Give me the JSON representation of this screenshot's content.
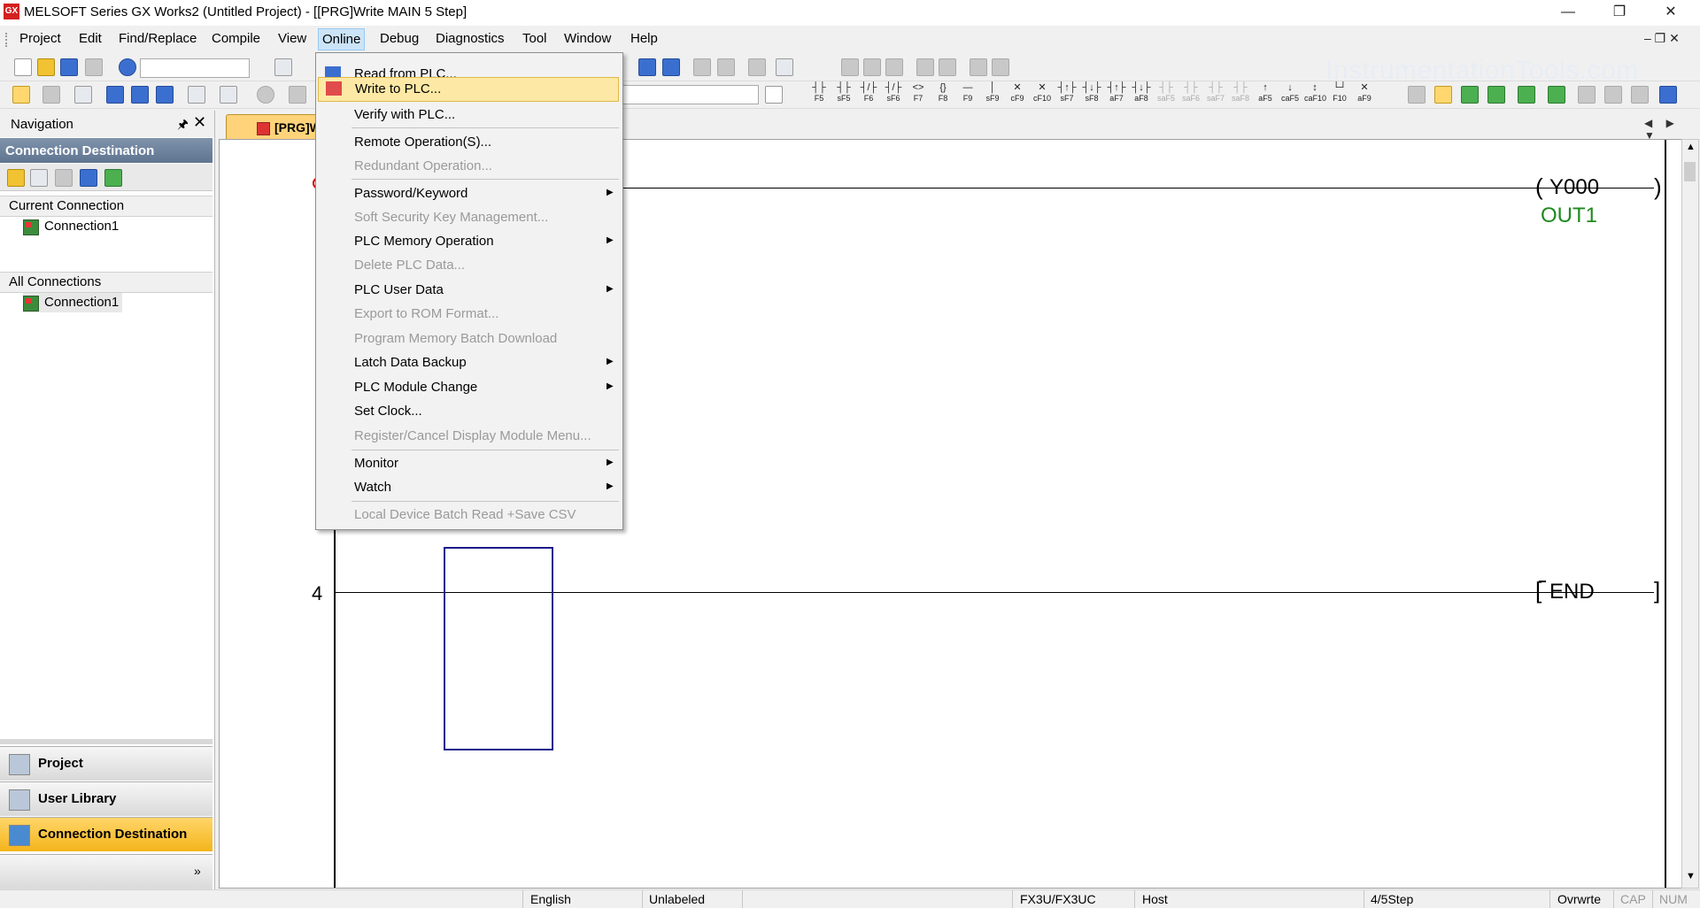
{
  "window": {
    "title": "MELSOFT Series GX Works2 (Untitled Project) - [[PRG]Write MAIN 5 Step]",
    "logo_text": "GX",
    "controls": {
      "minimize": "—",
      "restore": "❐",
      "close": "✕"
    },
    "mdi_controls": "‒ ❐ ✕"
  },
  "menubar": {
    "items": [
      {
        "label": "Project"
      },
      {
        "label": "Edit"
      },
      {
        "label": "Find/Replace"
      },
      {
        "label": "Compile"
      },
      {
        "label": "View"
      },
      {
        "label": "Online",
        "open": true
      },
      {
        "label": "Debug"
      },
      {
        "label": "Diagnostics"
      },
      {
        "label": "Tool"
      },
      {
        "label": "Window"
      },
      {
        "label": "Help"
      }
    ]
  },
  "online_menu": {
    "items": [
      {
        "label": "Read from PLC...",
        "enabled": true,
        "icon": "read-from-plc-icon"
      },
      {
        "label": "Write to PLC...",
        "enabled": true,
        "highlighted": true,
        "icon": "write-to-plc-icon"
      },
      {
        "label": "Verify with PLC...",
        "enabled": true
      },
      {
        "label": "Remote Operation(S)...",
        "enabled": true
      },
      {
        "label": "Redundant Operation...",
        "enabled": false
      },
      {
        "label": "Password/Keyword",
        "enabled": true,
        "submenu": true
      },
      {
        "label": "Soft Security Key Management...",
        "enabled": false
      },
      {
        "label": "PLC Memory Operation",
        "enabled": true,
        "submenu": true
      },
      {
        "label": "Delete PLC Data...",
        "enabled": false
      },
      {
        "label": "PLC User Data",
        "enabled": true,
        "submenu": true
      },
      {
        "label": "Export to ROM Format...",
        "enabled": false
      },
      {
        "label": "Program Memory Batch Download",
        "enabled": false
      },
      {
        "label": "Latch Data Backup",
        "enabled": true,
        "submenu": true
      },
      {
        "label": "PLC Module Change",
        "enabled": true,
        "submenu": true
      },
      {
        "label": "Set Clock...",
        "enabled": true
      },
      {
        "label": "Register/Cancel Display Module Menu...",
        "enabled": false
      },
      {
        "label": "Monitor",
        "enabled": true,
        "submenu": true
      },
      {
        "label": "Watch",
        "enabled": true,
        "submenu": true
      },
      {
        "label": "Local Device Batch Read +Save CSV",
        "enabled": false
      }
    ]
  },
  "function_keys": [
    {
      "sym": "┤├",
      "label": "F5"
    },
    {
      "sym": "┤├",
      "label": "sF5"
    },
    {
      "sym": "┤/├",
      "label": "F6"
    },
    {
      "sym": "┤/├",
      "label": "sF6"
    },
    {
      "sym": "<>",
      "label": "F7"
    },
    {
      "sym": "{}",
      "label": "F8"
    },
    {
      "sym": "—",
      "label": "F9"
    },
    {
      "sym": "│",
      "label": "sF9"
    },
    {
      "sym": "✕",
      "label": "cF9"
    },
    {
      "sym": "✕",
      "label": "cF10"
    },
    {
      "sym": "┤↑├",
      "label": "sF7"
    },
    {
      "sym": "┤↓├",
      "label": "sF8"
    },
    {
      "sym": "┤↑├",
      "label": "aF7"
    },
    {
      "sym": "┤↓├",
      "label": "aF8"
    },
    {
      "sym": "┤├",
      "label": "saF5",
      "dim": true
    },
    {
      "sym": "┤├",
      "label": "saF6",
      "dim": true
    },
    {
      "sym": "┤├",
      "label": "saF7",
      "dim": true
    },
    {
      "sym": "┤├",
      "label": "saF8",
      "dim": true
    },
    {
      "sym": "↑",
      "label": "aF5"
    },
    {
      "sym": "↓",
      "label": "caF5"
    },
    {
      "sym": "↕",
      "label": "caF10"
    },
    {
      "sym": "└┘",
      "label": "F10"
    },
    {
      "sym": "✕",
      "label": "aF9"
    }
  ],
  "watermark": "InstrumentationTools.com",
  "navigation": {
    "title": "Navigation",
    "pin": "🖈",
    "close": "✕",
    "section": "Connection Destination",
    "current_connection": {
      "header": "Current Connection",
      "item": "Connection1"
    },
    "all_connections": {
      "header": "All Connections",
      "item": "Connection1"
    },
    "tabs": [
      {
        "label": "Project"
      },
      {
        "label": "User Library"
      },
      {
        "label": "Connection Destination",
        "active": true
      }
    ],
    "more": "»"
  },
  "document_tab": {
    "label": "[PRG]W"
  },
  "tab_arrows": "◀ ▶ ▼",
  "ladder": {
    "rung0": {
      "coil": "Y000",
      "comment": "OUT1",
      "open_bracket": "(",
      "close_bracket": ")"
    },
    "rung4": {
      "step": "4",
      "instruction": "END",
      "open_bracket": "[",
      "close_bracket": "]"
    }
  },
  "scroll": {
    "up": "▲",
    "down": "▼"
  },
  "statusbar": {
    "language": "English",
    "label_state": "Unlabeled",
    "plc_type": "FX3U/FX3UC",
    "connection": "Host",
    "steps": "4/5Step",
    "mode": "Ovrwrte",
    "caps": "CAP",
    "num": "NUM"
  }
}
